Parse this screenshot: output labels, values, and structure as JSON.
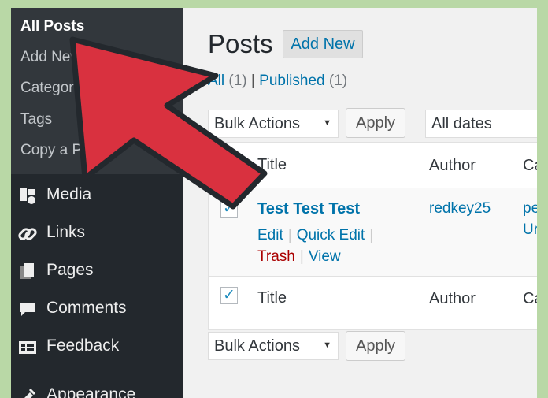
{
  "sidebar": {
    "submenu": [
      "All Posts",
      "Add New",
      "Categories",
      "Tags",
      "Copy a Post"
    ],
    "menu": [
      {
        "label": "Media",
        "icon": "media-icon"
      },
      {
        "label": "Links",
        "icon": "links-icon"
      },
      {
        "label": "Pages",
        "icon": "pages-icon"
      },
      {
        "label": "Comments",
        "icon": "comments-icon"
      },
      {
        "label": "Feedback",
        "icon": "feedback-icon"
      },
      {
        "label": "Appearance",
        "icon": "appearance-icon"
      }
    ]
  },
  "main": {
    "title": "Posts",
    "add_new": "Add New",
    "filters": {
      "all": "All",
      "all_count": "(1)",
      "separator": "|",
      "published": "Published",
      "published_count": "(1)"
    },
    "bulk_actions": "Bulk Actions",
    "apply": "Apply",
    "dates": "All dates",
    "columns": {
      "title": "Title",
      "author": "Author",
      "categories": "Ca"
    },
    "post": {
      "title": "Test Test Test",
      "author": "redkey25",
      "categories_line1": "pe",
      "categories_line2": "Ur",
      "actions": {
        "edit": "Edit",
        "quick_edit": "Quick Edit",
        "trash": "Trash",
        "view": "View",
        "separator": "|"
      }
    }
  },
  "colors": {
    "accent": "#0073aa",
    "sidebar_bg": "#23282d",
    "arrow": "#d9313f"
  }
}
